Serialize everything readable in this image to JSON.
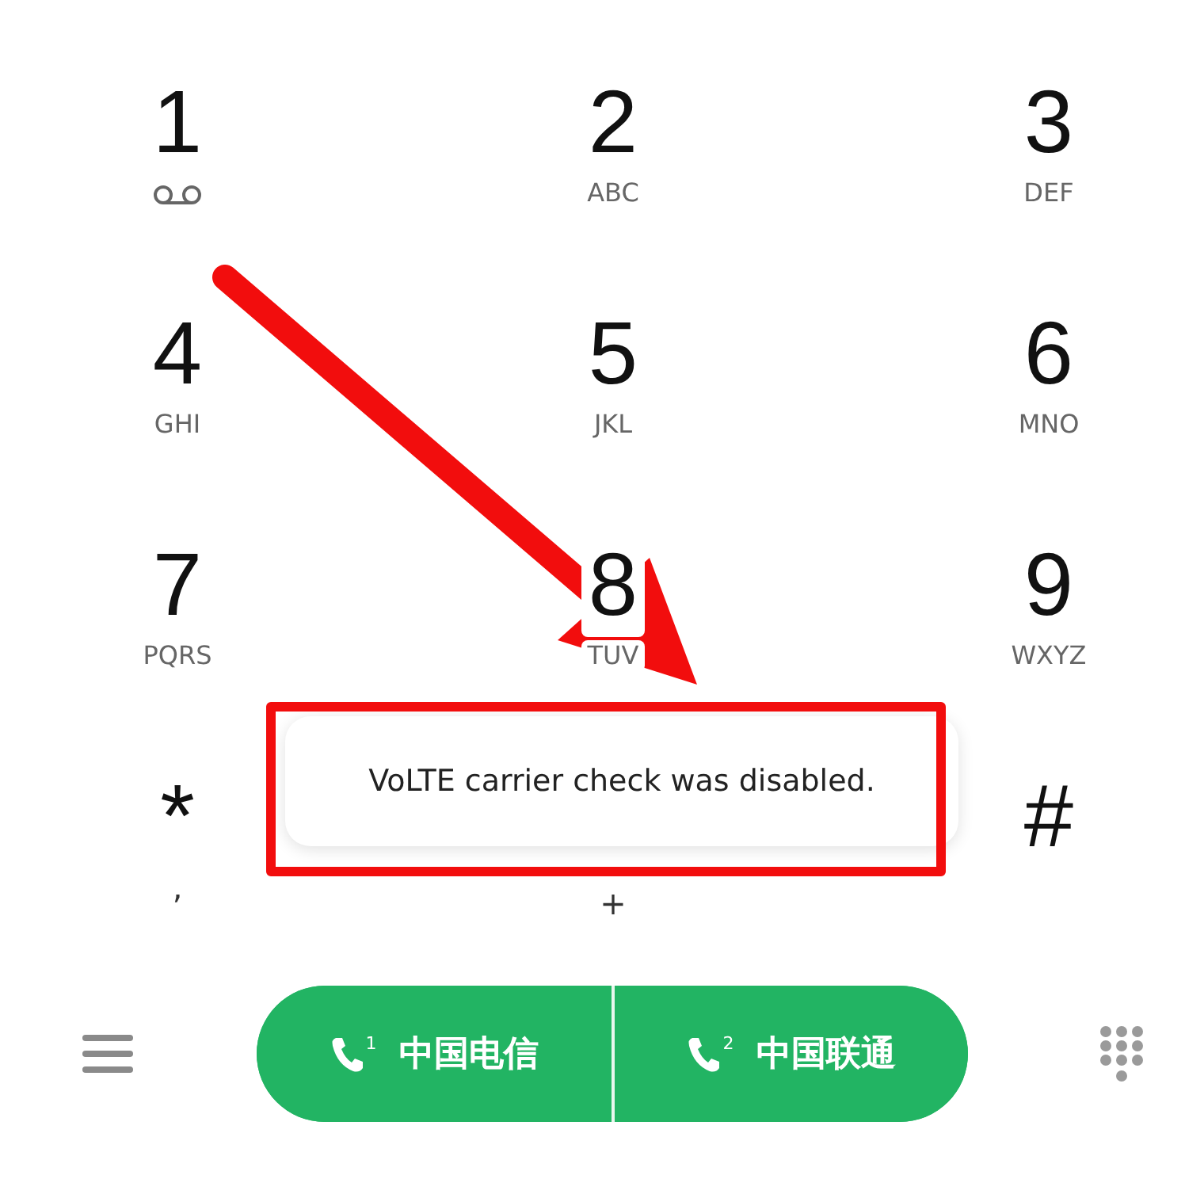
{
  "keypad_rows": [
    [
      {
        "digit": "1",
        "kind": "voicemail"
      },
      {
        "digit": "2",
        "kind": "letters",
        "letters": "ABC"
      },
      {
        "digit": "3",
        "kind": "letters",
        "letters": "DEF"
      }
    ],
    [
      {
        "digit": "4",
        "kind": "letters",
        "letters": "GHI"
      },
      {
        "digit": "5",
        "kind": "letters",
        "letters": "JKL"
      },
      {
        "digit": "6",
        "kind": "letters",
        "letters": "MNO"
      }
    ],
    [
      {
        "digit": "7",
        "kind": "letters",
        "letters": "PQRS"
      },
      {
        "digit": "8",
        "kind": "letters",
        "letters": "TUV"
      },
      {
        "digit": "9",
        "kind": "letters",
        "letters": "WXYZ"
      }
    ],
    [
      {
        "digit": "*",
        "kind": "letters",
        "letters": ","
      },
      {
        "kind": "letters",
        "letters": "+"
      },
      {
        "digit": "#",
        "kind": "letters"
      }
    ]
  ],
  "toast": {
    "message": "VoLTE carrier check was disabled."
  },
  "call_buttons": [
    {
      "sim": "1",
      "carrier": "中国电信"
    },
    {
      "sim": "2",
      "carrier": "中国联通"
    }
  ]
}
